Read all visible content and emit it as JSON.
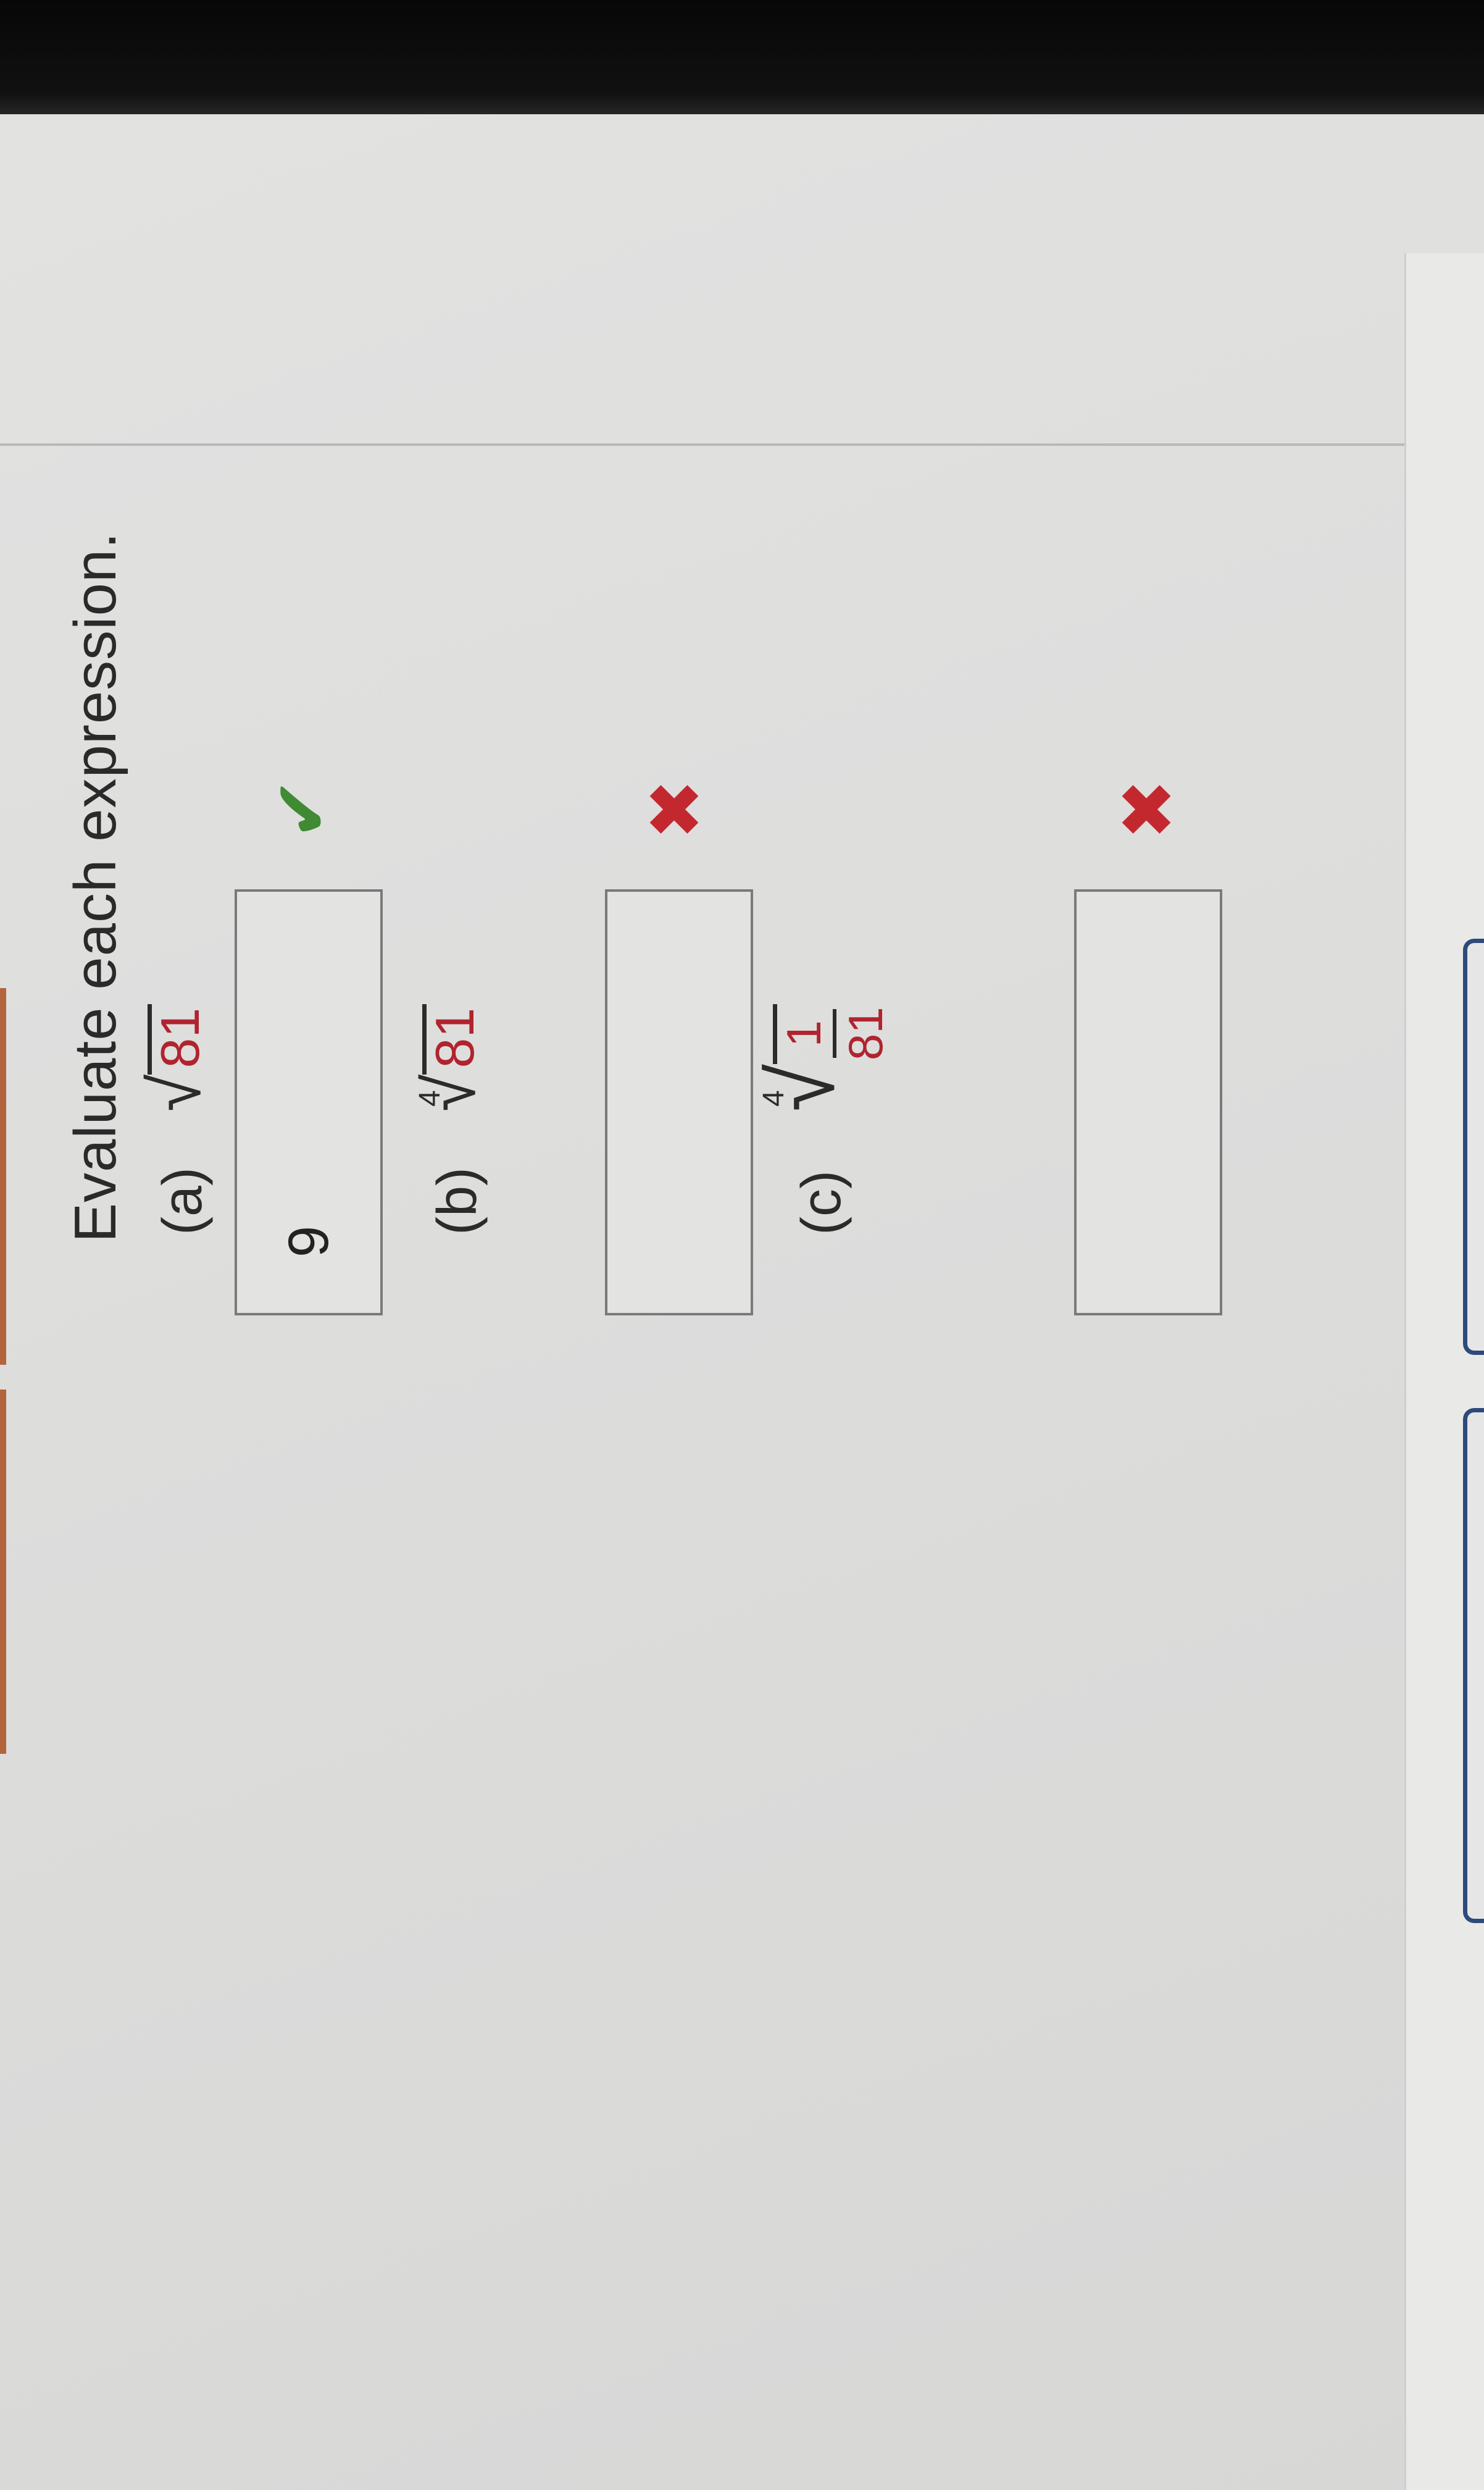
{
  "question": {
    "instruction": "Evaluate each expression.",
    "parts": [
      {
        "label": "(a)",
        "radicand": "81",
        "index": "",
        "answer_value": "9",
        "status_icon": "check-icon",
        "status_color": "#3f8a33"
      },
      {
        "label": "(b)",
        "radicand": "81",
        "index": "4",
        "answer_value": "",
        "status_icon": "x-icon",
        "status_color": "#c4282f"
      },
      {
        "label": "(c)",
        "numerator": "1",
        "denominator": "81",
        "index": "4",
        "answer_value": "",
        "status_icon": "x-icon",
        "status_color": "#c4282f"
      }
    ]
  },
  "colors": {
    "radicand_red": "#b0242f",
    "side_tab_blue": "#2d4a7a"
  }
}
